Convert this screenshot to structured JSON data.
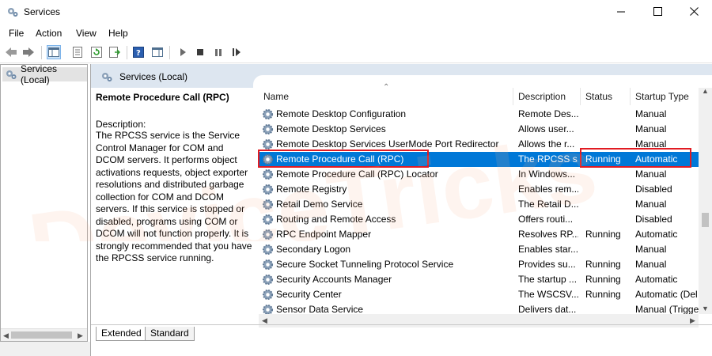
{
  "window": {
    "title": "Services",
    "app_icon": "gears-icon",
    "controls": [
      "minimize-icon",
      "maximize-icon",
      "close-icon"
    ]
  },
  "menu": [
    "File",
    "Action",
    "View",
    "Help"
  ],
  "toolbar": [
    "back-arrow-icon",
    "forward-arrow-icon",
    "show-hide-console-tree-icon",
    "properties-icon",
    "refresh-icon",
    "export-list-icon",
    "help-icon",
    "show-hide-action-pane-icon",
    "start-service-icon",
    "stop-service-icon",
    "pause-service-icon",
    "restart-service-icon"
  ],
  "tree": {
    "item_label": "Services (Local)"
  },
  "panel_header": {
    "title": "Services (Local)"
  },
  "description_panel": {
    "service_name": "Remote Procedure Call (RPC)",
    "label": "Description:",
    "lines": [
      "The RPCSS service is the Service",
      "Control Manager for COM and",
      "DCOM servers. It performs object",
      "activations requests, object exporter",
      "resolutions and distributed garbage",
      "collection for COM and DCOM",
      "servers. If this service is stopped or",
      "disabled, programs using COM or",
      "DCOM will not function properly. It is",
      "strongly recommended that you have",
      "the RPCSS service running."
    ]
  },
  "columns": {
    "name": "Name",
    "description": "Description",
    "status": "Status",
    "startup": "Startup Type"
  },
  "services": [
    {
      "name": "Remote Desktop Configuration",
      "description": "Remote Des...",
      "status": "",
      "startup": "Manual"
    },
    {
      "name": "Remote Desktop Services",
      "description": "Allows user...",
      "status": "",
      "startup": "Manual"
    },
    {
      "name": "Remote Desktop Services UserMode Port Redirector",
      "description": "Allows the r...",
      "status": "",
      "startup": "Manual"
    },
    {
      "name": "Remote Procedure Call (RPC)",
      "description": "The RPCSS s...",
      "status": "Running",
      "startup": "Automatic",
      "selected": true
    },
    {
      "name": "Remote Procedure Call (RPC) Locator",
      "description": "In Windows...",
      "status": "",
      "startup": "Manual"
    },
    {
      "name": "Remote Registry",
      "description": "Enables rem...",
      "status": "",
      "startup": "Disabled"
    },
    {
      "name": "Retail Demo Service",
      "description": "The Retail D...",
      "status": "",
      "startup": "Manual"
    },
    {
      "name": "Routing and Remote Access",
      "description": "Offers routi...",
      "status": "",
      "startup": "Disabled"
    },
    {
      "name": "RPC Endpoint Mapper",
      "description": "Resolves RP...",
      "status": "Running",
      "startup": "Automatic"
    },
    {
      "name": "Secondary Logon",
      "description": "Enables star...",
      "status": "",
      "startup": "Manual"
    },
    {
      "name": "Secure Socket Tunneling Protocol Service",
      "description": "Provides su...",
      "status": "Running",
      "startup": "Manual"
    },
    {
      "name": "Security Accounts Manager",
      "description": "The startup ...",
      "status": "Running",
      "startup": "Automatic"
    },
    {
      "name": "Security Center",
      "description": "The WSCSV...",
      "status": "Running",
      "startup": "Automatic (Del"
    },
    {
      "name": "Sensor Data Service",
      "description": "Delivers dat...",
      "status": "",
      "startup": "Manual (Trigge"
    }
  ],
  "tabs": [
    "Extended",
    "Standard"
  ],
  "colors": {
    "selection": "#0078d7",
    "highlight_box": "#e11b22",
    "header_band": "#dde6f0"
  },
  "watermark": {
    "text": "DeviceTricks"
  }
}
